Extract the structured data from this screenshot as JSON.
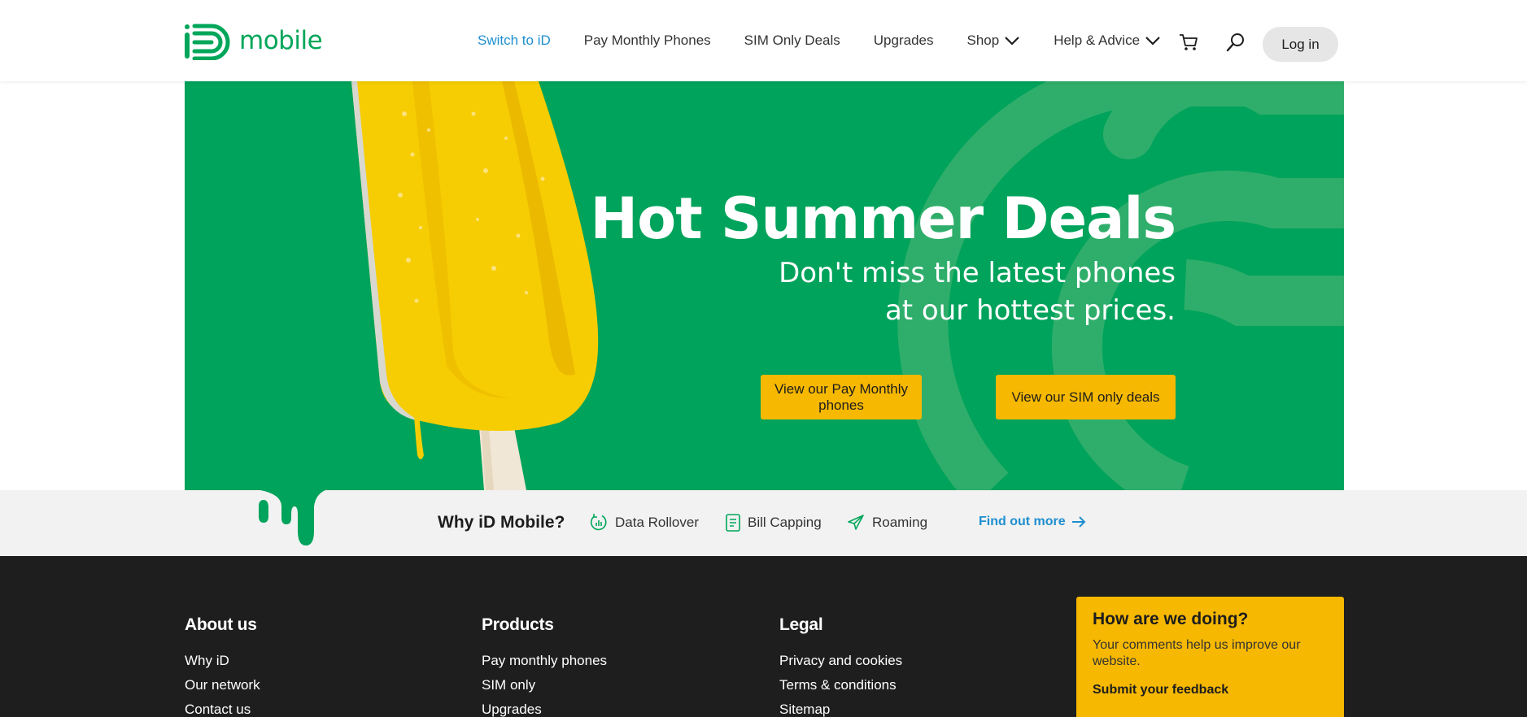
{
  "brand": {
    "name": "mobile",
    "logo_icon": "id-logo-icon",
    "color": "#00a65a"
  },
  "nav": {
    "items": [
      {
        "label": "Switch to iD",
        "active": true
      },
      {
        "label": "Pay Monthly Phones"
      },
      {
        "label": "SIM Only Deals"
      },
      {
        "label": "Upgrades"
      },
      {
        "label": "Shop",
        "icon": "chevron-down-icon"
      },
      {
        "label": "Help & Advice",
        "icon": "chevron-down-icon"
      }
    ],
    "cart_icon": "cart-icon",
    "search_icon": "search-icon",
    "login_label": "Log in"
  },
  "hero": {
    "title": "Hot Summer Deals",
    "subtitle_line1": "Don't miss the latest phones",
    "subtitle_line2": "at our hottest prices.",
    "button1": "View our Pay Monthly phones",
    "button2": "View our SIM only deals",
    "background_color": "#00a35b",
    "button_color": "#f6b800"
  },
  "why": {
    "title": "Why iD Mobile?",
    "items": [
      {
        "label": "Data Rollover",
        "icon": "data-rollover-icon"
      },
      {
        "label": "Bill Capping",
        "icon": "bill-capping-icon"
      },
      {
        "label": "Roaming",
        "icon": "plane-icon"
      }
    ],
    "link": "Find out more",
    "link_icon": "arrow-right-icon"
  },
  "footer": {
    "about": {
      "title": "About us",
      "links": [
        "Why iD",
        "Our network",
        "Contact us"
      ]
    },
    "products": {
      "title": "Products",
      "links": [
        "Pay monthly phones",
        "SIM only",
        "Upgrades"
      ]
    },
    "legal": {
      "title": "Legal",
      "links": [
        "Privacy and cookies",
        "Terms & conditions",
        "Sitemap"
      ]
    },
    "feedback": {
      "title": "How are we doing?",
      "text": "Your comments help us improve our website.",
      "link": "Submit your feedback"
    }
  }
}
